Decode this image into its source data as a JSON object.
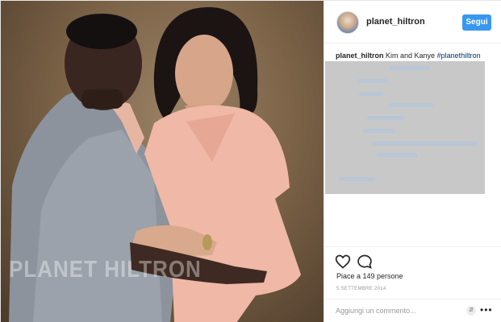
{
  "post": {
    "username": "planet_hiltron",
    "follow_label": "Segui",
    "caption": {
      "username": "planet_hiltron",
      "text": "Kim and Kanye",
      "hashtag": "#planethiltron"
    },
    "likes": "Piace a 149 persone",
    "date": "5 SETTEMBRE 2014",
    "comment_placeholder": "Aggiungi un commento...",
    "watermark": "PLANET HILTRON"
  },
  "icons": [
    "heart-icon",
    "comment-icon",
    "sort-icon",
    "more-options-icon"
  ],
  "colors": {
    "accent": "#3897f0",
    "hashtag": "#003569",
    "redaction": "#c8c8c8"
  }
}
